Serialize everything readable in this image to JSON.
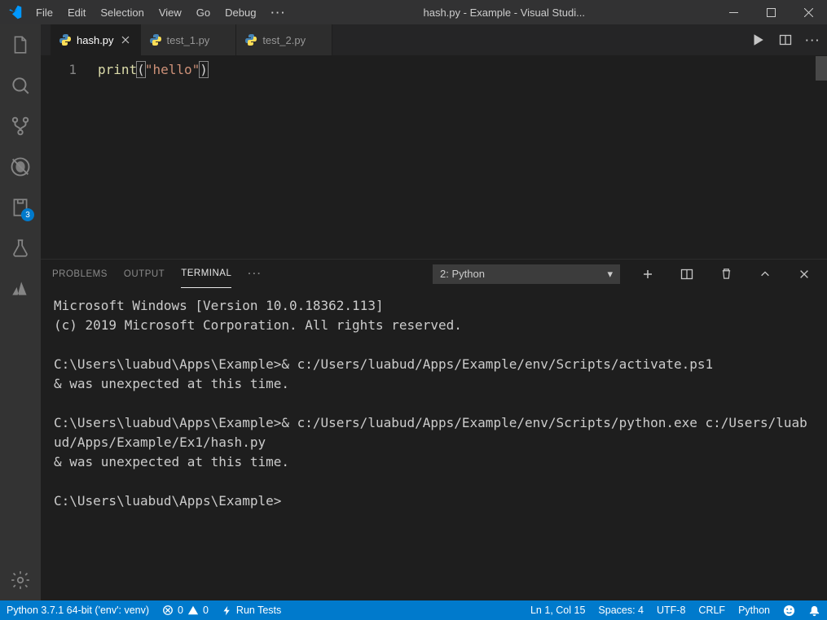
{
  "titlebar": {
    "menus": [
      "File",
      "Edit",
      "Selection",
      "View",
      "Go",
      "Debug"
    ],
    "overflow": "···",
    "title": "hash.py - Example - Visual Studi..."
  },
  "activitybar": {
    "test_badge": "3"
  },
  "tabs": [
    {
      "label": "hash.py",
      "active": true
    },
    {
      "label": "test_1.py",
      "active": false
    },
    {
      "label": "test_2.py",
      "active": false
    }
  ],
  "editor": {
    "line_number": "1",
    "fn": "print",
    "open": "(",
    "str": "\"hello\"",
    "close": ")"
  },
  "panel": {
    "tabs": {
      "problems": "Problems",
      "output": "Output",
      "terminal": "Terminal"
    },
    "overflow": "···",
    "select": "2: Python",
    "terminal_lines": [
      "Microsoft Windows [Version 10.0.18362.113]",
      "(c) 2019 Microsoft Corporation. All rights reserved.",
      "",
      "C:\\Users\\luabud\\Apps\\Example>& c:/Users/luabud/Apps/Example/env/Scripts/activate.ps1",
      "& was unexpected at this time.",
      "",
      "C:\\Users\\luabud\\Apps\\Example>& c:/Users/luabud/Apps/Example/env/Scripts/python.exe c:/Users/luabud/Apps/Example/Ex1/hash.py",
      "& was unexpected at this time.",
      "",
      "C:\\Users\\luabud\\Apps\\Example>"
    ]
  },
  "statusbar": {
    "interpreter": "Python 3.7.1 64-bit ('env': venv)",
    "errors": "0",
    "warnings": "0",
    "run_tests": "Run Tests",
    "position": "Ln 1, Col 15",
    "spaces": "Spaces: 4",
    "encoding": "UTF-8",
    "eol": "CRLF",
    "language": "Python"
  }
}
